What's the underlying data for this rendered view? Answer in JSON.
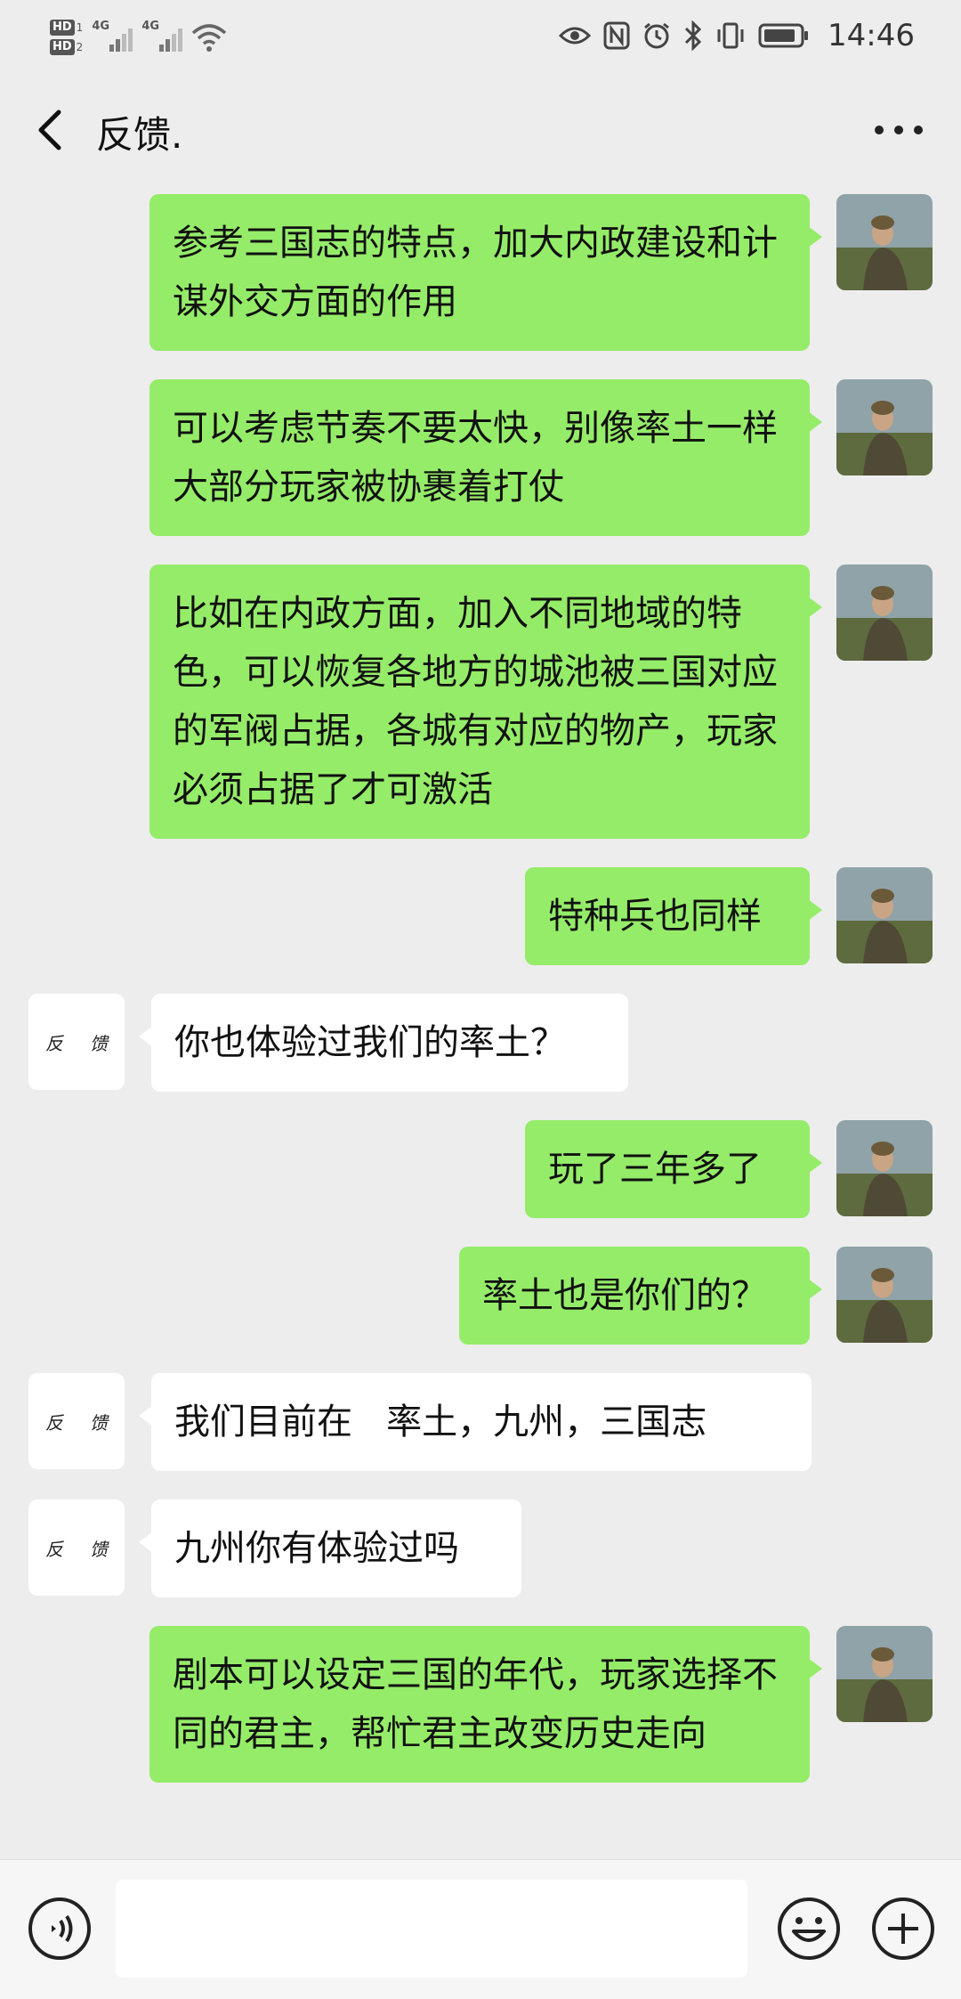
{
  "status_bar": {
    "hd1": "HD",
    "hd1_num": "1",
    "hd2": "HD",
    "hd2_num": "2",
    "net1": "4G",
    "net2": "4G",
    "time": "14:46"
  },
  "header": {
    "title": "反馈."
  },
  "feedback_avatar_text": [
    "反",
    "馈"
  ],
  "messages": [
    {
      "side": "right",
      "text": "参考三国志的特点，加大内政建设和计谋外交方面的作用"
    },
    {
      "side": "right",
      "text": "可以考虑节奏不要太快，别像率土一样大部分玩家被协裹着打仗"
    },
    {
      "side": "right",
      "text": "比如在内政方面，加入不同地域的特色，可以恢复各地方的城池被三国对应的军阀占据，各城有对应的物产，玩家必须占据了才可激活"
    },
    {
      "side": "right",
      "text": "特种兵也同样"
    },
    {
      "side": "left",
      "text": "你也体验过我们的率土？"
    },
    {
      "side": "right",
      "text": "玩了三年多了"
    },
    {
      "side": "right",
      "text": "率土也是你们的？"
    },
    {
      "side": "left",
      "text": "我们目前在   率土，九州，三国志"
    },
    {
      "side": "left",
      "text": "九州你有体验过吗"
    },
    {
      "side": "right",
      "text": "剧本可以设定三国的年代，玩家选择不同的君主，帮忙君主改变历史走向"
    }
  ],
  "icons": {
    "back": "chevron-left-icon",
    "more": "more-dots-icon",
    "voice": "voice-input-icon",
    "emoji": "emoji-icon",
    "plus": "plus-icon"
  },
  "colors": {
    "bubble_self": "#95ec69",
    "bubble_other": "#ffffff",
    "background": "#ededed"
  }
}
